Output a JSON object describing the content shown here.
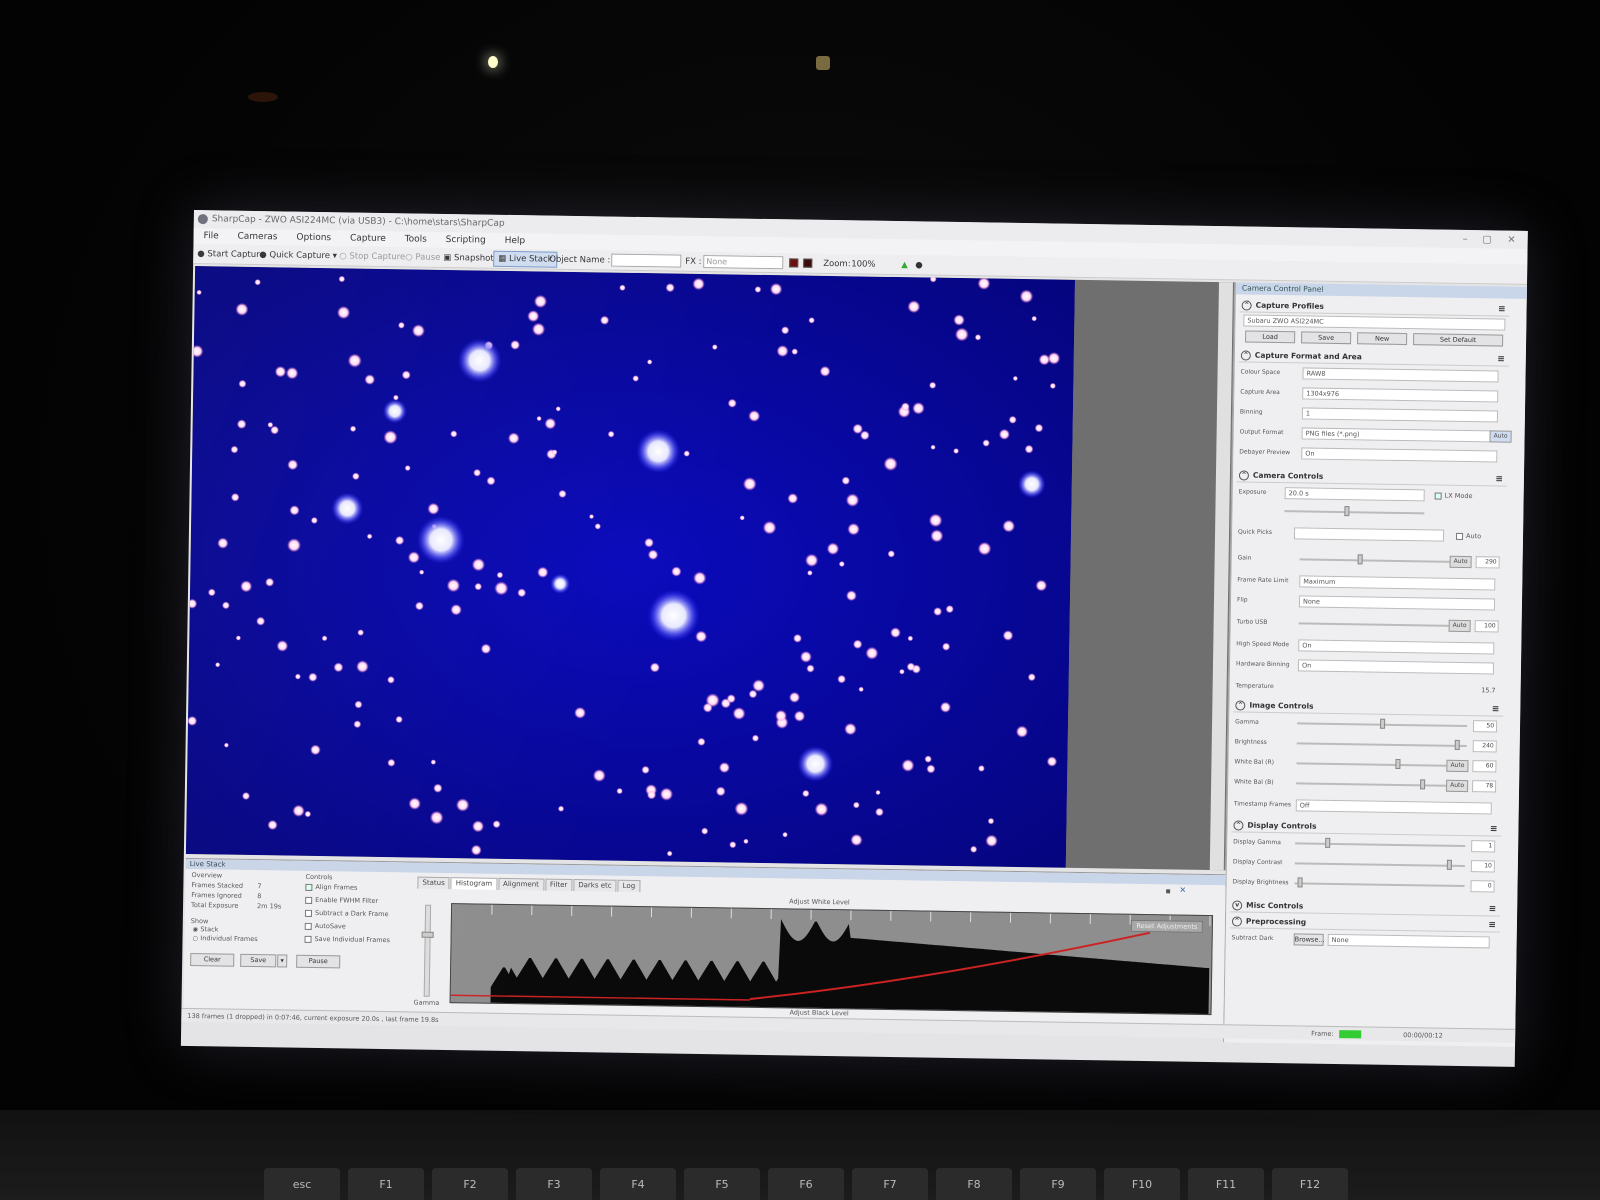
{
  "window": {
    "title": "SharpCap - ZWO ASI224MC (via USB3) - C:\\home\\stars\\SharpCap",
    "minimize": "–",
    "maximize": "▢",
    "close": "✕"
  },
  "menu": [
    "File",
    "Cameras",
    "Options",
    "Capture",
    "Tools",
    "Scripting",
    "Help"
  ],
  "toolbar": {
    "start_capture": "Start Capture",
    "quick_capture": "Quick Capture",
    "stop_capture": "Stop Capture",
    "pause": "Pause",
    "snapshot": "Snapshot",
    "live_stack": "Live Stack",
    "object_name_label": "Object Name :",
    "fx_label": "FX :",
    "fx_value": "None",
    "zoom_label": "Zoom:",
    "zoom_value": "100%"
  },
  "camera_panel": {
    "title": "Camera Control Panel",
    "capture_profiles": {
      "header": "Capture Profiles",
      "profile": "Subaru ZWO ASI224MC",
      "buttons": [
        "Load",
        "Save",
        "New",
        "Set Default"
      ]
    },
    "capture_format": {
      "header": "Capture Format and Area",
      "rows": [
        {
          "label": "Colour Space",
          "value": "RAW8"
        },
        {
          "label": "Capture Area",
          "value": "1304x976"
        },
        {
          "label": "Binning",
          "value": "1"
        },
        {
          "label": "Output Format",
          "value": "PNG files (*.png)"
        },
        {
          "label": "Debayer Preview",
          "value": "On"
        }
      ],
      "auto": "Auto"
    },
    "camera_controls": {
      "header": "Camera Controls",
      "exposure_label": "Exposure",
      "exposure_value": "20.0 s",
      "lx_mode": "LX Mode",
      "quick_picks_label": "Quick Picks",
      "quick_picks_auto": "Auto",
      "sliders": [
        {
          "label": "Gain",
          "value": "290",
          "auto": "Auto",
          "level": 0.35
        },
        {
          "label": "Turbo USB",
          "value": "100",
          "auto": "Auto",
          "level": 0.98
        }
      ],
      "rows": [
        {
          "label": "Frame Rate Limit",
          "value": "Maximum"
        },
        {
          "label": "Flip",
          "value": "None"
        },
        {
          "label": "High Speed Mode",
          "value": "On"
        },
        {
          "label": "Hardware Binning",
          "value": "On"
        }
      ],
      "temperature_label": "Temperature",
      "temperature_value": "15.7"
    },
    "image_controls": {
      "header": "Image Controls",
      "sliders": [
        {
          "label": "Gamma",
          "value": "50",
          "auto": "",
          "level": 0.5
        },
        {
          "label": "Brightness",
          "value": "240",
          "auto": "",
          "level": 0.96
        },
        {
          "label": "White Bal (R)",
          "value": "60",
          "auto": "Auto",
          "level": 0.6
        },
        {
          "label": "White Bal (B)",
          "value": "78",
          "auto": "Auto",
          "level": 0.75
        }
      ],
      "timestamp_label": "Timestamp Frames",
      "timestamp_value": "Off"
    },
    "display_controls": {
      "header": "Display Controls",
      "sliders": [
        {
          "label": "Display Gamma",
          "value": "1",
          "level": 0.18
        },
        {
          "label": "Display Contrast",
          "value": "10",
          "level": 0.92
        },
        {
          "label": "Display Brightness",
          "value": "0",
          "level": 0.02
        }
      ]
    },
    "misc_controls": {
      "header": "Misc Controls"
    },
    "preprocessing": {
      "header": "Preprocessing",
      "subtract_dark_label": "Subtract Dark",
      "browse": "Browse...",
      "value": "None"
    }
  },
  "live_stack": {
    "title": "Live Stack",
    "overview_label": "Overview",
    "frames_stacked_label": "Frames Stacked",
    "frames_stacked": "7",
    "frames_ignored_label": "Frames Ignored",
    "frames_ignored": "8",
    "total_exposure_label": "Total Exposure",
    "total_exposure": "2m 19s",
    "show_label": "Show",
    "show_stack": "Stack",
    "show_individual": "Individual Frames",
    "controls_label": "Controls",
    "options": [
      "Align Frames",
      "Enable FWHM Filter",
      "Subtract a Dark Frame",
      "AutoSave",
      "Save Individual Frames"
    ],
    "buttons": [
      "Clear",
      "Save",
      "Pause"
    ],
    "tabs": [
      "Status",
      "Histogram",
      "Alignment",
      "Filter",
      "Darks etc",
      "Log"
    ],
    "active_tab": "Histogram",
    "adjust_white": "Adjust White Level",
    "adjust_black": "Adjust Black Level",
    "reset": "Reset Adjustments",
    "gamma": "Gamma"
  },
  "status_bar": {
    "left": "138 frames (1 dropped) in 0:07:46, current exposure 20.0s , last frame 19.8s",
    "frame_label": "Frame:",
    "time": "00:00/00:12"
  },
  "colors": {
    "sky": "#0a0ab8",
    "sky_edge": "#05058a",
    "star_core": "#ffffff",
    "histogram_curve": "#cc2222"
  },
  "keyboard": [
    "esc",
    "F1",
    "F2",
    "F3",
    "F4",
    "F5",
    "F6",
    "F7",
    "F8",
    "F9",
    "F10",
    "F11",
    "F12"
  ]
}
